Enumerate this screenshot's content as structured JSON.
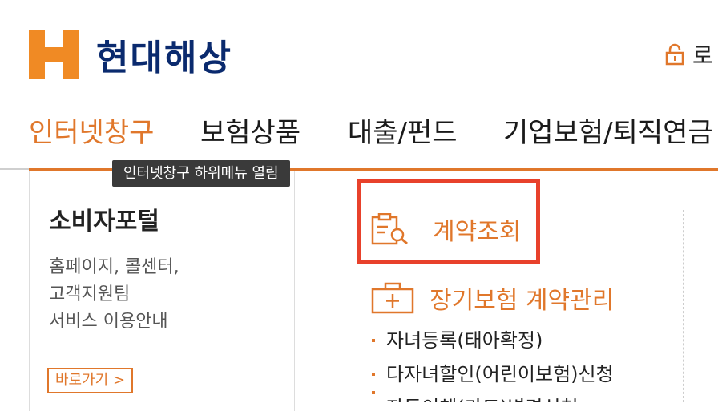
{
  "header": {
    "logo_text": "현대해상",
    "login_text": "로"
  },
  "gnb": {
    "items": [
      "인터넷창구",
      "보험상품",
      "대출/펀드",
      "기업보험/퇴직연금"
    ],
    "active_index": 0
  },
  "tooltip": "인터넷창구 하위메뉴 열림",
  "consumer_portal": {
    "title": "소비자포털",
    "desc": [
      "홈페이지, 콜센터,",
      "고객지원팀",
      "서비스 이용안내"
    ],
    "button": "바로가기 >"
  },
  "menu": {
    "contract_inquiry": "계약조회",
    "long_term": "장기보험 계약관리",
    "sub_items": [
      "자녀등록(태아확정)",
      "다자녀할인(어린이보험)신청",
      "자동이체(카드)변경신청"
    ]
  },
  "colors": {
    "accent": "#e0772b",
    "highlight": "#e8412b",
    "brand_navy": "#0a2a6e"
  }
}
